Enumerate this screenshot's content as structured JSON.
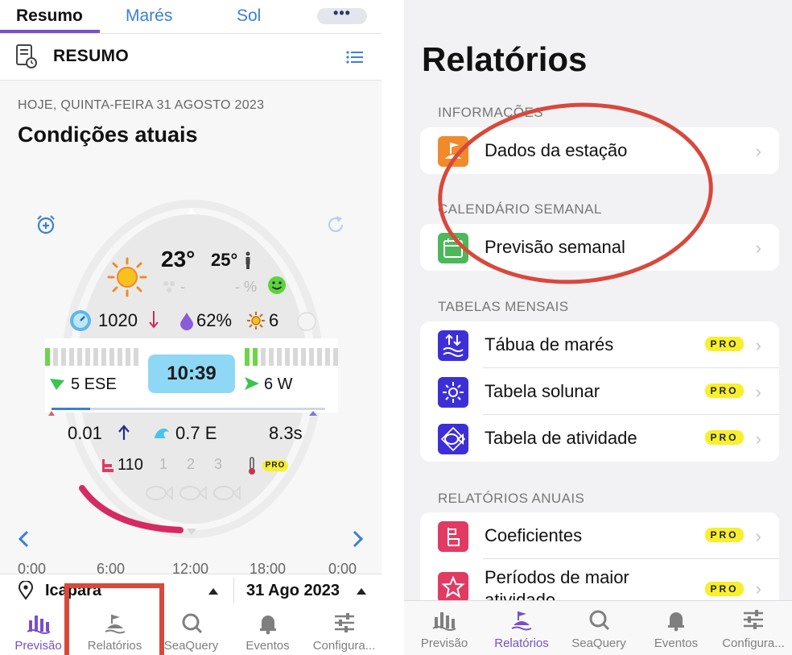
{
  "left": {
    "tabs": [
      "Resumo",
      "Marés",
      "Sol"
    ],
    "more_label": "•••",
    "header_title": "RESUMO",
    "date_line": "HOJE, QUINTA-FEIRA 31 AGOSTO 2023",
    "section_title": "Condições atuais",
    "temp": "23°",
    "feels": "25°",
    "rain_dash": "-",
    "humidity_dash": "- %",
    "pressure": "1020",
    "humidity": "62%",
    "uv": "6",
    "wind_left": "5 ESE",
    "wind_right": "6 W",
    "time_hours": "10",
    "time_minutes": ":39",
    "tide_value": "0.01",
    "swell": "0.7 E",
    "period": "8.3s",
    "activity": "110",
    "activity_levels": [
      "1",
      "2",
      "3"
    ],
    "pro": "PRO",
    "timeline": [
      "0:00",
      "6:00",
      "12:00",
      "18:00",
      "0:00"
    ],
    "location": "Icapara",
    "date_selected": "31 Ago 2023",
    "nav": [
      "Previsão",
      "Relatórios",
      "SeaQuery",
      "Eventos",
      "Configura..."
    ]
  },
  "right": {
    "title": "Relatórios",
    "sections": {
      "info": "INFORMAÇÕES",
      "weekly": "CALENDÁRIO SEMANAL",
      "monthly": "TABELAS MENSAIS",
      "yearly": "RELATÓRIOS ANUAIS"
    },
    "items": {
      "station": "Dados da estação",
      "weekly_forecast": "Previsão semanal",
      "tides": "Tábua de marés",
      "solunar": "Tabela solunar",
      "activity": "Tabela de atividade",
      "coefficients": "Coeficientes",
      "periods_line1": "Períodos de maior",
      "periods_line2": "atividade"
    },
    "pro": "PRO",
    "chevron": "›",
    "nav": [
      "Previsão",
      "Relatórios",
      "SeaQuery",
      "Eventos",
      "Configura..."
    ]
  },
  "colors": {
    "accent": "#7a4fc8",
    "link": "#3b7fd6",
    "highlight": "#d9483b",
    "pro": "#f7ef2c",
    "station_icon": "#f08a2b",
    "weekly_icon": "#4cb85a",
    "monthly_icon": "#3d2fd8",
    "yearly_icon": "#e13b63"
  }
}
